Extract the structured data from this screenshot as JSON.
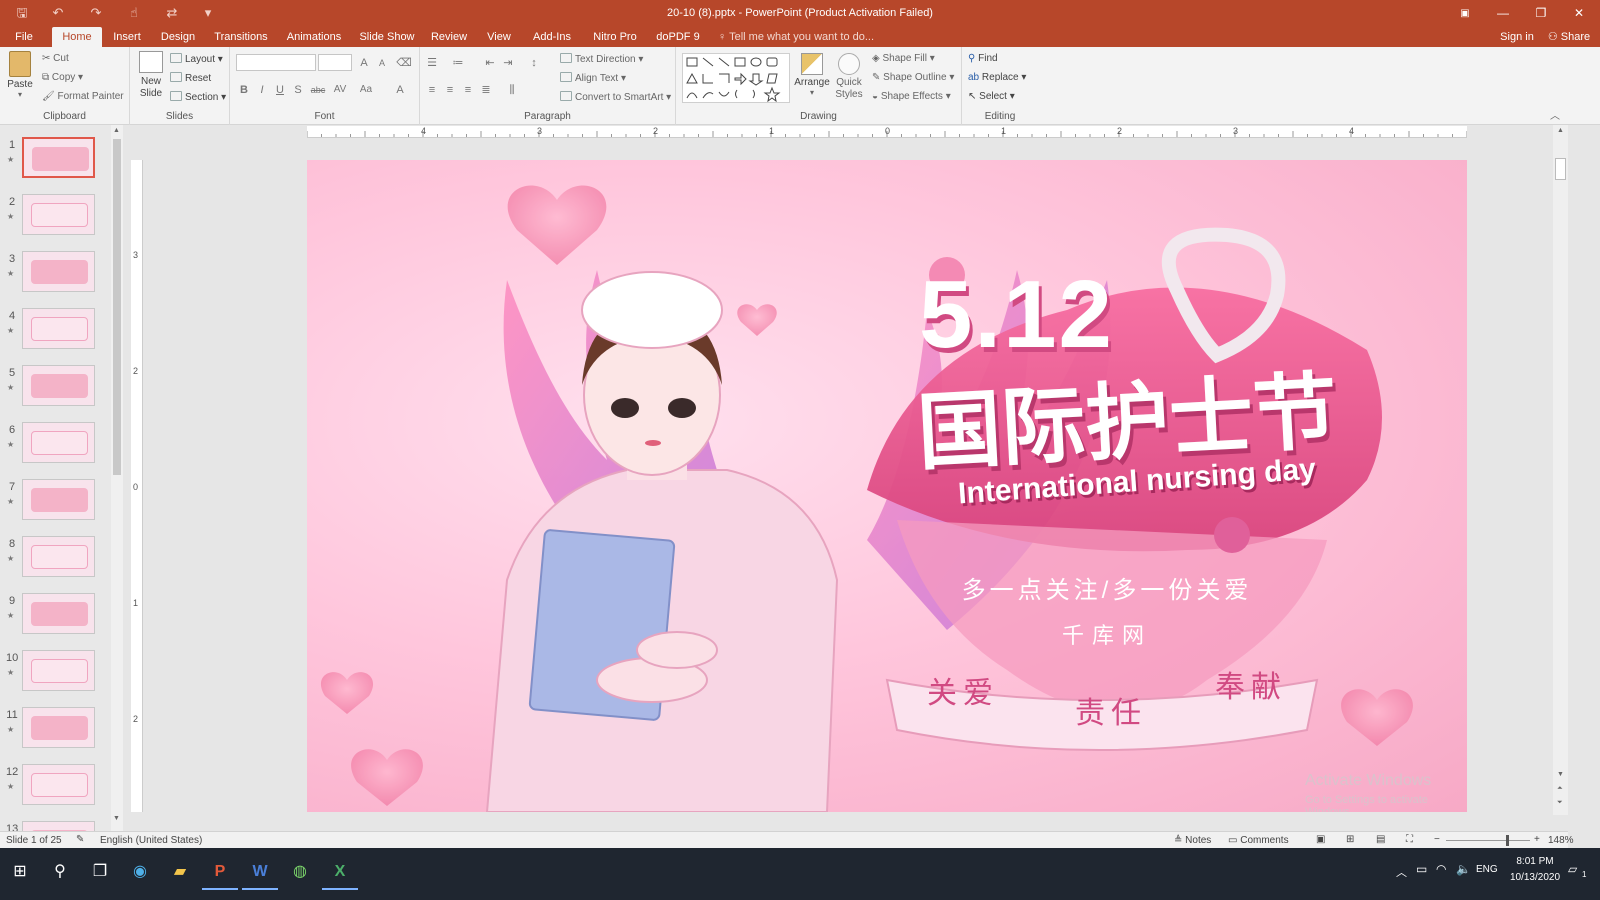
{
  "window": {
    "title": "20-10 (8).pptx - PowerPoint (Product Activation Failed)"
  },
  "qat": {
    "save": "🖫",
    "undo": "↶",
    "redo": "↷",
    "touch": "☝",
    "customize": "▾"
  },
  "tabs": [
    "File",
    "Home",
    "Insert",
    "Design",
    "Transitions",
    "Animations",
    "Slide Show",
    "Review",
    "View",
    "Add-Ins",
    "Nitro Pro",
    "doPDF 9"
  ],
  "tell_me": "Tell me what you want to do...",
  "sign_in": "Sign in",
  "share": "Share",
  "ribbon": {
    "clipboard": {
      "paste": "Paste",
      "cut": "Cut",
      "copy": "Copy",
      "format_painter": "Format Painter",
      "label": "Clipboard"
    },
    "slides": {
      "new_slide": "New Slide",
      "layout": "Layout",
      "reset": "Reset",
      "section": "Section",
      "label": "Slides"
    },
    "font": {
      "label": "Font",
      "bold": "B",
      "italic": "I",
      "underline": "U",
      "strike": "S",
      "abc": "abc",
      "spacing": "AV",
      "case": "Aa",
      "color": "A",
      "grow": "A",
      "shrink": "A"
    },
    "paragraph": {
      "text_direction": "Text Direction",
      "align_text": "Align Text",
      "convert": "Convert to SmartArt",
      "label": "Paragraph"
    },
    "drawing": {
      "arrange": "Arrange",
      "quick_styles": "Quick Styles",
      "shape_fill": "Shape Fill",
      "shape_outline": "Shape Outline",
      "shape_effects": "Shape Effects",
      "label": "Drawing"
    },
    "editing": {
      "find": "Find",
      "replace": "Replace",
      "select": "Select",
      "label": "Editing"
    }
  },
  "ruler": {
    "h": [
      "4",
      "3",
      "2",
      "1",
      "0",
      "1",
      "2",
      "3",
      "4"
    ],
    "v": [
      "3",
      "2",
      "1",
      "0",
      "1",
      "2"
    ]
  },
  "thumbnails": [
    "1",
    "2",
    "3",
    "4",
    "5",
    "6",
    "7",
    "8",
    "9",
    "10",
    "11",
    "12",
    "13"
  ],
  "slide": {
    "date": "5.12",
    "title_cn": "国际护士节",
    "title_en": "International nursing day",
    "slogan": "多一点关注/多一份关爱",
    "site": "千库网",
    "ribbon_words": [
      "关爱",
      "责任",
      "奉献"
    ]
  },
  "watermark": {
    "title": "Activate Windows",
    "sub": "Go to Settings to activate Windows."
  },
  "status": {
    "slide": "Slide 1 of 25",
    "lang": "English (United States)",
    "notes": "Notes",
    "comments": "Comments",
    "zoom": "148%",
    "zoom_value": 148
  },
  "taskbar": {
    "lang": "ENG",
    "time": "8:01 PM",
    "date": "10/13/2020",
    "notif": "1"
  },
  "colors": {
    "accent": "#b7472a",
    "slide_pink": "#f7a9c6",
    "title_bar": "#b7472a"
  }
}
